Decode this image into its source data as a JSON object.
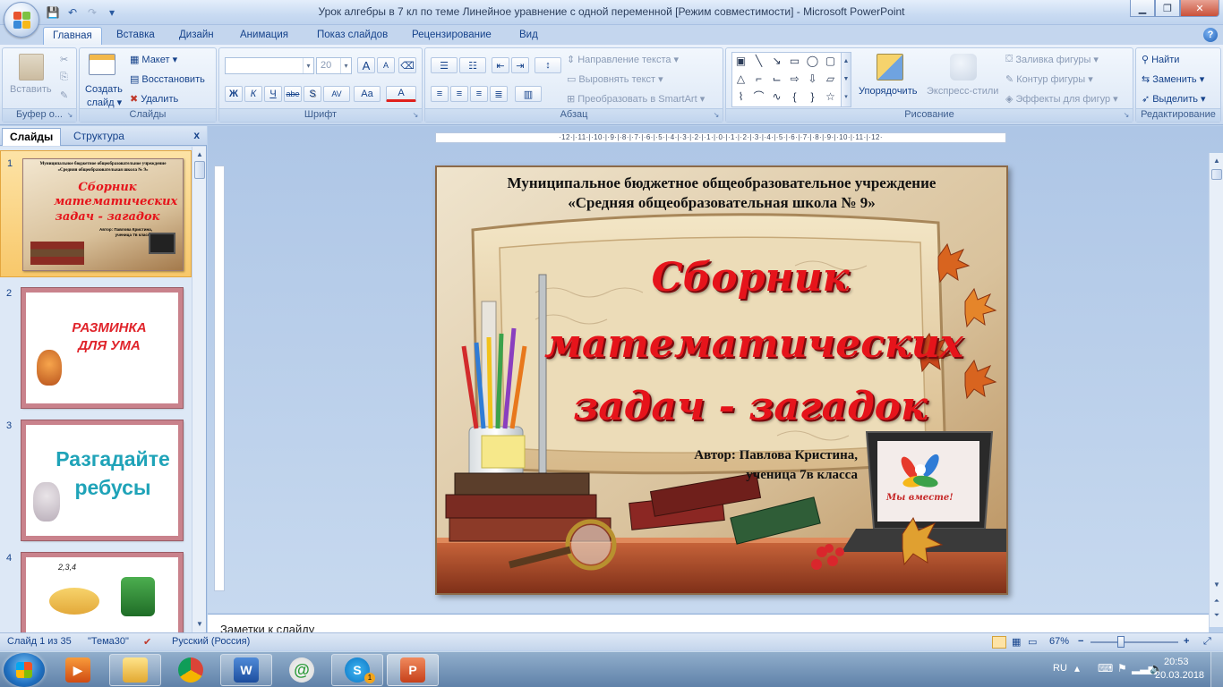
{
  "window": {
    "title": "Урок алгебры в 7 кл по теме  Линейное уравнение с одной переменной [Режим совместимости] - Microsoft PowerPoint",
    "minimize": "▁",
    "maximize": "❐",
    "close": "✕"
  },
  "qat": {
    "save": "💾",
    "undo": "↶",
    "redo": "↷",
    "customize": "▾"
  },
  "tabs": [
    "Главная",
    "Вставка",
    "Дизайн",
    "Анимация",
    "Показ слайдов",
    "Рецензирование",
    "Вид"
  ],
  "active_tab": "Главная",
  "ribbon": {
    "clipboard": {
      "label": "Буфер о...",
      "paste": "Вставить"
    },
    "slides": {
      "label": "Слайды",
      "new_slide": "Создать",
      "new_slide2": "слайд ▾",
      "layout": "Макет ▾",
      "reset": "Восстановить",
      "delete": "Удалить"
    },
    "font": {
      "label": "Шрифт",
      "font_name": "",
      "font_size": "20",
      "bold": "Ж",
      "italic": "К",
      "underline": "Ч",
      "strike": "abe",
      "shadow": "S",
      "spacing": "AV",
      "case": "Aa",
      "color": "A",
      "grow": "A",
      "shrink": "A"
    },
    "paragraph": {
      "label": "Абзац",
      "text_direction": "Направление текста ▾",
      "align_text": "Выровнять текст ▾",
      "smartart": "Преобразовать в SmartArt ▾"
    },
    "drawing": {
      "label": "Рисование",
      "arrange": "Упорядочить",
      "quick_styles": "Экспресс-стили",
      "fill": "Заливка фигуры ▾",
      "outline": "Контур фигуры ▾",
      "effects": "Эффекты для фигур ▾"
    },
    "editing": {
      "label": "Редактирование",
      "find": "Найти",
      "replace": "Заменить ▾",
      "select": "Выделить ▾"
    }
  },
  "pane": {
    "tab_slides": "Слайды",
    "tab_outline": "Структура",
    "close": "x",
    "thumbnails": [
      {
        "num": "1",
        "line1": "Муниципальное бюджетное общеобразовательное учреждение",
        "line2": "«Средняя общеобразовательная школа № 9»",
        "title": "Сборник математических задач - загадок",
        "author1": "Автор: Павлова Кристина,",
        "author2": "ученица 7в класса"
      },
      {
        "num": "2",
        "title": "РАЗМИНКА ДЛЯ УМА"
      },
      {
        "num": "3",
        "title": "Разгадайте ребусы"
      },
      {
        "num": "4",
        "caption": "2,3,4"
      }
    ]
  },
  "ruler": {
    "horizontal": "·12·|·11·|·10·|·9·|·8·|·7·|·6·|·5·|·4·|·3·|·2·|·1·|·0·|·1·|·2·|·3·|·4·|·5·|·6·|·7·|·8·|·9·|·10·|·11·|·12·"
  },
  "slide": {
    "school_line1": "Муниципальное бюджетное общеобразовательное учреждение",
    "school_line2": "«Средняя общеобразовательная школа № 9»",
    "title_line1": "Сборник",
    "title_line2": "математических",
    "title_line3": "задач - загадок",
    "author_line1": "Автор: Павлова Кристина,",
    "author_line2": "ученица 7в класса",
    "laptop_caption": "Мы вместе!"
  },
  "notes": {
    "placeholder": "Заметки к слайду"
  },
  "status": {
    "slide_info": "Слайд 1 из 35",
    "theme": "\"Тема30\"",
    "language": "Русский (Россия)",
    "zoom": "67%",
    "zoom_minus": "−",
    "zoom_plus": "+"
  },
  "taskbar": {
    "language": "RU",
    "time": "20:53",
    "date": "20.03.2018",
    "skype_badge": "1"
  },
  "colors": {
    "ribbon_bg": "#dde8f6",
    "title_red": "#e6141b",
    "accent": "#15428b"
  }
}
